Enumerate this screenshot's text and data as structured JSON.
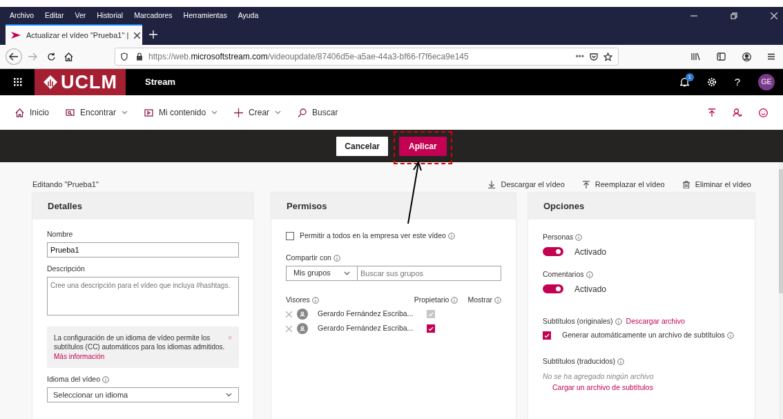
{
  "browser": {
    "menu": [
      "Archivo",
      "Editar",
      "Ver",
      "Historial",
      "Marcadores",
      "Herramientas",
      "Ayuda"
    ],
    "tab": {
      "title": "Actualizar el vídeo \"Prueba1\" |",
      "selected": true
    },
    "url": {
      "scheme": "https://web.",
      "domain": "microsoftstream.com",
      "path": "/videoupdate/87406d5e-a5ae-44a3-bf66-f7f6eca9e145"
    },
    "page_actions": "•••"
  },
  "app": {
    "logo": "UCLM",
    "title": "Stream",
    "notification_count": "1",
    "help": "?",
    "avatar": "GE"
  },
  "nav": [
    {
      "label": "Inicio",
      "dropdown": false
    },
    {
      "label": "Encontrar",
      "dropdown": true
    },
    {
      "label": "Mi contenido",
      "dropdown": true
    },
    {
      "label": "Crear",
      "dropdown": true
    },
    {
      "label": "Buscar",
      "dropdown": false
    }
  ],
  "actions": [
    {
      "label": "Cancelar",
      "primary": false
    },
    {
      "label": "Aplicar",
      "primary": true
    }
  ],
  "editing": "Editando \"Prueba1\"",
  "video_actions": [
    "Descargar el vídeo",
    "Reemplazar el vídeo",
    "Eliminar el vídeo"
  ],
  "details": {
    "title": "Detalles",
    "name_label": "Nombre",
    "name_value": "Prueba1",
    "description_label": "Descripción",
    "description_placeholder": "Cree una descripción para el vídeo que incluya #hashtags.",
    "notice": "La configuración de un idioma de vídeo permite los subtítulos (CC) automáticos para los idiomas admitidos.",
    "notice_link": "Más información",
    "notice_close": "×",
    "language_label": "Idioma del vídeo",
    "language_value": "Seleccionar un idioma"
  },
  "permissions": {
    "title": "Permisos",
    "allow_all": {
      "label": "Permitir a todos en la empresa ver este vídeo",
      "checked": false
    },
    "share_label": "Compartir con",
    "share_scope": "Mis grupos",
    "share_placeholder": "Buscar sus grupos",
    "viewers_label": "Visores",
    "owner_label": "Propietario",
    "show_label": "Mostrar",
    "viewers": [
      {
        "name": "Gerardo Fernández Escriba...",
        "owner": true,
        "disabled": true
      },
      {
        "name": "Gerardo Fernández Escriba...",
        "owner": true,
        "disabled": false
      }
    ]
  },
  "options": {
    "title": "Opciones",
    "toggles": [
      {
        "label": "Personas",
        "state": "Activado",
        "on": true
      },
      {
        "label": "Comentarios",
        "state": "Activado",
        "on": true
      }
    ],
    "subtitles_label": "Subtítulos (originales)",
    "subtitles_download": "Descargar archivo",
    "auto_generate": {
      "label": "Generar automáticamente un archivo de subtítulos",
      "checked": true
    },
    "translated_label": "Subtítulos (traducidos)",
    "translated_empty": "No se ha agregado ningún archivo",
    "translated_upload": "Cargar un archivo de subtítulos"
  },
  "annotations": [
    {
      "kind": "highlight-box"
    },
    {
      "kind": "arrow"
    }
  ]
}
